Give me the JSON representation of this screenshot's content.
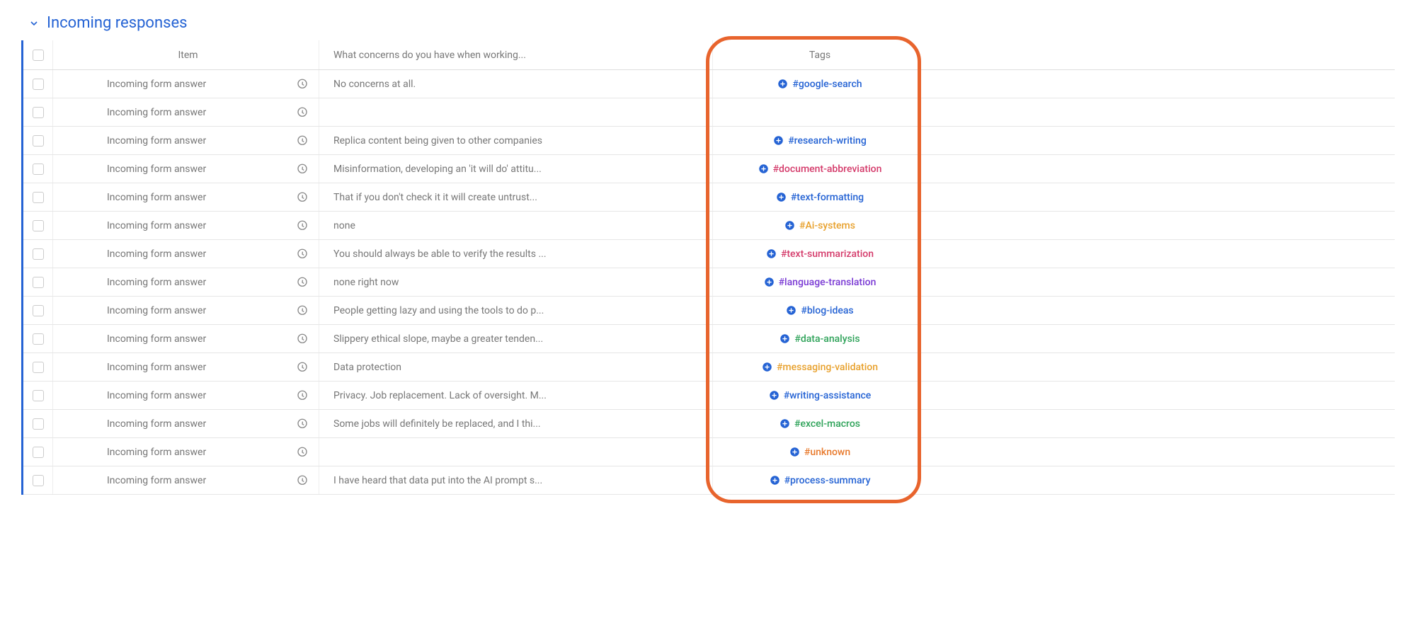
{
  "section": {
    "title": "Incoming responses"
  },
  "headers": {
    "item": "Item",
    "concerns": "What concerns do you have when working...",
    "tags": "Tags"
  },
  "rows": [
    {
      "item": "Incoming form answer",
      "concerns": "No concerns at all.",
      "tag": "#google-search",
      "tagColor": "#2563d4"
    },
    {
      "item": "Incoming form answer",
      "concerns": "",
      "tag": "",
      "tagColor": ""
    },
    {
      "item": "Incoming form answer",
      "concerns": "Replica content being given to other companies",
      "tag": "#research-writing",
      "tagColor": "#2563d4"
    },
    {
      "item": "Incoming form answer",
      "concerns": "Misinformation, developing an 'it will do' attitu...",
      "tag": "#document-abbreviation",
      "tagColor": "#d43a6a"
    },
    {
      "item": "Incoming form answer",
      "concerns": "That if you don't check it it will create untrust...",
      "tag": "#text-formatting",
      "tagColor": "#2563d4"
    },
    {
      "item": "Incoming form answer",
      "concerns": "none",
      "tag": "#Ai-systems",
      "tagColor": "#e8a12d"
    },
    {
      "item": "Incoming form answer",
      "concerns": "You should always be able to verify the results ...",
      "tag": "#text-summarization",
      "tagColor": "#d43a6a"
    },
    {
      "item": "Incoming form answer",
      "concerns": "none right now",
      "tag": "#language-translation",
      "tagColor": "#7a3ad4"
    },
    {
      "item": "Incoming form answer",
      "concerns": "People getting lazy and using the tools to do p...",
      "tag": "#blog-ideas",
      "tagColor": "#2563d4"
    },
    {
      "item": "Incoming form answer",
      "concerns": "Slippery ethical slope, maybe a greater tenden...",
      "tag": "#data-analysis",
      "tagColor": "#2fa35a"
    },
    {
      "item": "Incoming form answer",
      "concerns": "Data protection",
      "tag": "#messaging-validation",
      "tagColor": "#e8a12d"
    },
    {
      "item": "Incoming form answer",
      "concerns": "Privacy. Job replacement. Lack of oversight. M...",
      "tag": "#writing-assistance",
      "tagColor": "#2563d4"
    },
    {
      "item": "Incoming form answer",
      "concerns": "Some jobs will definitely be replaced, and I thi...",
      "tag": "#excel-macros",
      "tagColor": "#2fa35a"
    },
    {
      "item": "Incoming form answer",
      "concerns": "",
      "tag": "#unknown",
      "tagColor": "#e87a2d"
    },
    {
      "item": "Incoming form answer",
      "concerns": "I have heard that data put into the AI prompt s...",
      "tag": "#process-summary",
      "tagColor": "#2563d4"
    }
  ]
}
